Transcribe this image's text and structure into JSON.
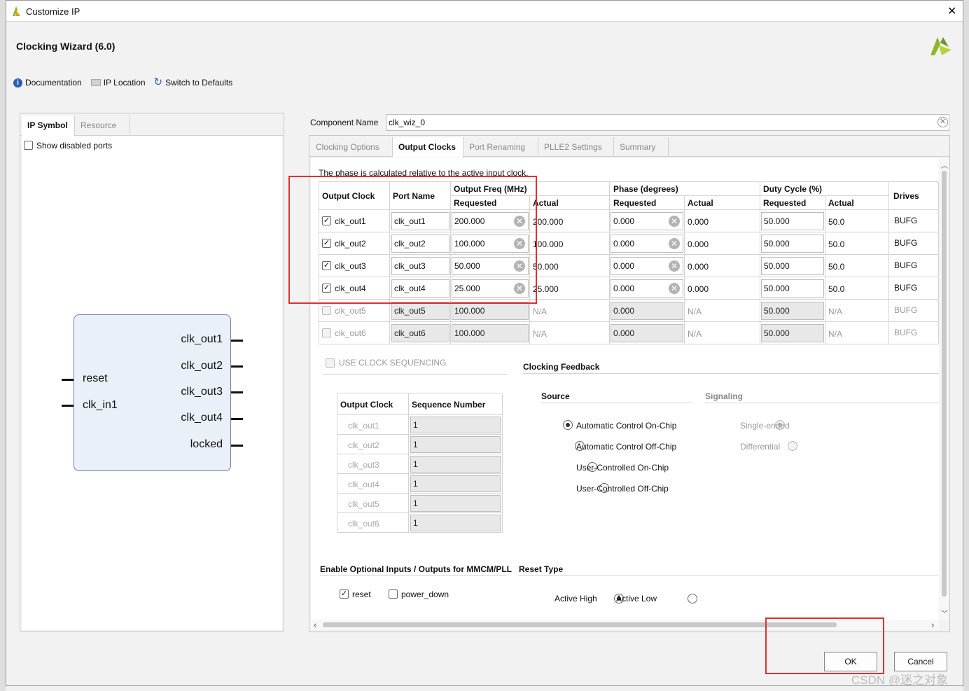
{
  "window": {
    "title": "Customize IP",
    "close": "✕"
  },
  "header": {
    "title": "Clocking Wizard (6.0)"
  },
  "toolbar": {
    "documentation": "Documentation",
    "ip_location": "IP Location",
    "switch_defaults": "Switch to Defaults"
  },
  "left": {
    "tabs": [
      "IP Symbol",
      "Resource"
    ],
    "show_disabled_label": "Show disabled ports",
    "symbol": {
      "inputs": [
        "reset",
        "clk_in1"
      ],
      "outputs": [
        "clk_out1",
        "clk_out2",
        "clk_out3",
        "clk_out4",
        "locked"
      ]
    }
  },
  "component": {
    "label": "Component Name",
    "value": "clk_wiz_0"
  },
  "tabs": [
    "Clocking Options",
    "Output Clocks",
    "Port Renaming",
    "PLLE2 Settings",
    "Summary"
  ],
  "output": {
    "note": "The phase is calculated relative to the active input clock.",
    "headers": {
      "output_clock": "Output Clock",
      "port_name": "Port Name",
      "output_freq": "Output Freq (MHz)",
      "phase": "Phase (degrees)",
      "duty": "Duty Cycle (%)",
      "requested": "Requested",
      "actual": "Actual",
      "drives": "Drives"
    },
    "rows": [
      {
        "name": "clk_out1",
        "port": "clk_out1",
        "freq": "200.000",
        "freq_act": "200.000",
        "phase": "0.000",
        "phase_act": "0.000",
        "duty": "50.000",
        "duty_act": "50.0",
        "drives": "BUFG"
      },
      {
        "name": "clk_out2",
        "port": "clk_out2",
        "freq": "100.000",
        "freq_act": "100.000",
        "phase": "0.000",
        "phase_act": "0.000",
        "duty": "50.000",
        "duty_act": "50.0",
        "drives": "BUFG"
      },
      {
        "name": "clk_out3",
        "port": "clk_out3",
        "freq": "50.000",
        "freq_act": "50.000",
        "phase": "0.000",
        "phase_act": "0.000",
        "duty": "50.000",
        "duty_act": "50.0",
        "drives": "BUFG"
      },
      {
        "name": "clk_out4",
        "port": "clk_out4",
        "freq": "25.000",
        "freq_act": "25.000",
        "phase": "0.000",
        "phase_act": "0.000",
        "duty": "50.000",
        "duty_act": "50.0",
        "drives": "BUFG"
      },
      {
        "name": "clk_out5",
        "port": "clk_out5",
        "freq": "100.000",
        "freq_act": "N/A",
        "phase": "0.000",
        "phase_act": "N/A",
        "duty": "50.000",
        "duty_act": "N/A",
        "drives": "BUFG"
      },
      {
        "name": "clk_out6",
        "port": "clk_out6",
        "freq": "100.000",
        "freq_act": "N/A",
        "phase": "0.000",
        "phase_act": "N/A",
        "duty": "50.000",
        "duty_act": "N/A",
        "drives": "BUFG"
      }
    ]
  },
  "sequencing": {
    "label": "USE CLOCK SEQUENCING",
    "col_clock": "Output Clock",
    "col_seq": "Sequence Number",
    "rows": [
      {
        "clock": "clk_out1",
        "seq": "1"
      },
      {
        "clock": "clk_out2",
        "seq": "1"
      },
      {
        "clock": "clk_out3",
        "seq": "1"
      },
      {
        "clock": "clk_out4",
        "seq": "1"
      },
      {
        "clock": "clk_out5",
        "seq": "1"
      },
      {
        "clock": "clk_out6",
        "seq": "1"
      }
    ]
  },
  "feedback": {
    "title": "Clocking Feedback",
    "source": "Source",
    "signaling": "Signaling",
    "source_options": [
      "Automatic Control On-Chip",
      "Automatic Control Off-Chip",
      "User-Controlled On-Chip",
      "User-Controlled Off-Chip"
    ],
    "signaling_options": [
      "Single-ended",
      "Differential"
    ]
  },
  "optional": {
    "title": "Enable Optional Inputs / Outputs for MMCM/PLL",
    "reset": "reset",
    "power_down": "power_down"
  },
  "reset_type": {
    "title": "Reset Type",
    "high": "Active High",
    "low": "Active Low"
  },
  "buttons": {
    "ok": "OK",
    "cancel": "Cancel"
  },
  "watermark": "CSDN @迷之对象",
  "colors": {
    "highlight": "#e03030",
    "logo": "#8ab82a"
  }
}
